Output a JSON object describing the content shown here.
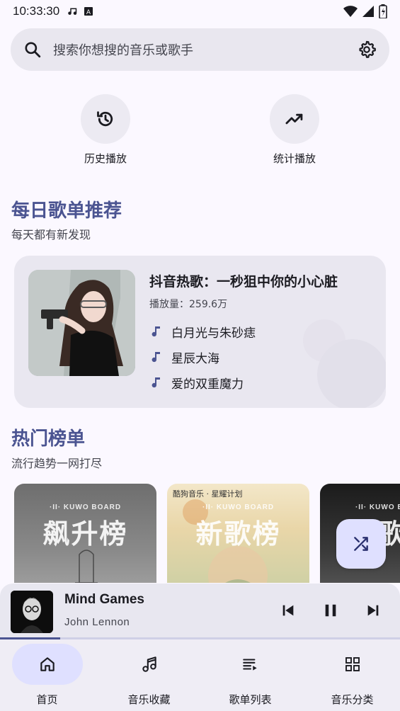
{
  "status_bar": {
    "time": "10:33:30"
  },
  "search": {
    "placeholder": "搜索你想搜的音乐或歌手"
  },
  "quick_actions": [
    {
      "label": "历史播放",
      "icon": "history-icon"
    },
    {
      "label": "统计播放",
      "icon": "trending-up-icon"
    }
  ],
  "daily": {
    "title": "每日歌单推荐",
    "subtitle": "每天都有新发现",
    "playlist": {
      "name": "抖音热歌：一秒狙中你的小心脏",
      "plays": "播放量：259.6万",
      "songs": [
        "白月光与朱砂痣",
        "星辰大海",
        "爱的双重魔力"
      ]
    }
  },
  "hot": {
    "title": "热门榜单",
    "subtitle": "流行趋势一网打尽",
    "boards": [
      {
        "brand": "·II· KUWO BOARD",
        "name": "飙升榜",
        "tag": ""
      },
      {
        "brand": "·II· KUWO BOARD",
        "name": "新歌榜",
        "tag": "酷狗音乐 · 星耀计划"
      },
      {
        "brand": "·II· KUWO BOARD",
        "name": "热歌榜",
        "tag": ""
      }
    ]
  },
  "player": {
    "title": "Mind Games",
    "artist": "John Lennon",
    "progress": 0.15
  },
  "nav": [
    {
      "label": "首页",
      "icon": "home-icon",
      "active": true
    },
    {
      "label": "音乐收藏",
      "icon": "music-note-icon",
      "active": false
    },
    {
      "label": "歌单列表",
      "icon": "playlist-icon",
      "active": false
    },
    {
      "label": "音乐分类",
      "icon": "grid-icon",
      "active": false
    }
  ],
  "colors": {
    "accent": "#4b5491",
    "surface": "#e9e7f0",
    "nav_active": "#dfe0ff"
  }
}
